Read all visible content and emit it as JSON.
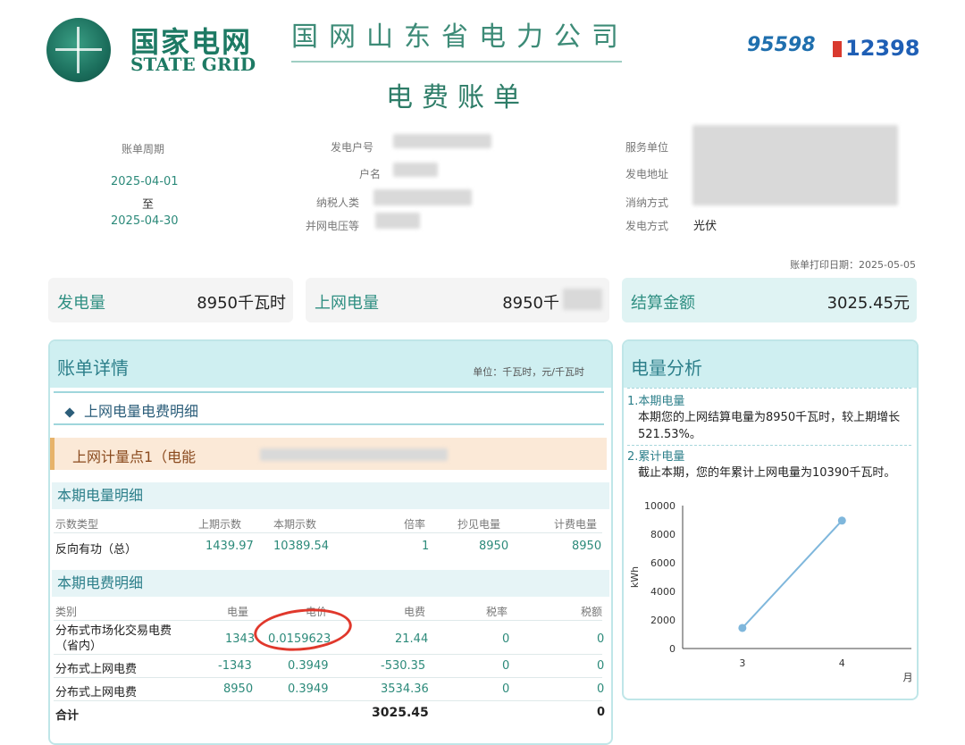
{
  "header": {
    "logo_cn": "国家电网",
    "logo_en": "STATE GRID",
    "company": "国网山东省电力公司",
    "title": "电费账单",
    "hotline1": "95598",
    "hotline2": "12398"
  },
  "info": {
    "period_label": "账单周期",
    "period_from": "2025-04-01",
    "period_to_word": "至",
    "period_to": "2025-04-30",
    "gen_account_label": "发电户号",
    "account_name_label": "户名",
    "taxpayer_label": "纳税人类",
    "voltage_label": "并网电压等",
    "service_unit_label": "服务单位",
    "gen_address_label": "发电地址",
    "consume_label": "消纳方式",
    "gen_mode_label": "发电方式",
    "gen_mode_value": "光伏",
    "print_date": "账单打印日期：2025-05-05"
  },
  "summary": {
    "gen_label": "发电量",
    "gen_value": "8950千瓦时",
    "grid_label": "上网电量",
    "grid_value": "8950千",
    "settle_label": "结算金额",
    "settle_value": "3025.45元"
  },
  "detail": {
    "title": "账单详情",
    "unit": "单位：千瓦时，元/千瓦时",
    "section": "上网电量电费明细",
    "meter": "上网计量点1（电能",
    "energy_head": "本期电量明细",
    "energy_cols": [
      "示数类型",
      "上期示数",
      "本期示数",
      "倍率",
      "抄见电量",
      "计费电量"
    ],
    "energy_row": [
      "反向有功（总）",
      "1439.97",
      "10389.54",
      "1",
      "8950",
      "8950"
    ],
    "fee_head": "本期电费明细",
    "fee_cols": [
      "类别",
      "电量",
      "电价",
      "电费",
      "税率",
      "税额"
    ],
    "fee_rows": [
      [
        "分布式市场化交易电费（省内）",
        "1343",
        "0.0159623",
        "21.44",
        "0",
        "0"
      ],
      [
        "分布式上网电费",
        "-1343",
        "0.3949",
        "-530.35",
        "0",
        "0"
      ],
      [
        "分布式上网电费",
        "8950",
        "0.3949",
        "3534.36",
        "0",
        "0"
      ]
    ],
    "total_label": "合计",
    "total_fee": "3025.45",
    "total_tax": "0"
  },
  "analysis": {
    "title": "电量分析",
    "h1": "1.本期电量",
    "t1": "本期您的上网结算电量为8950千瓦时，较上期增长521.53%。",
    "h2": "2.累计电量",
    "t2": "截止本期，您的年累计上网电量为10390千瓦时。"
  },
  "chart_data": {
    "type": "line",
    "x": [
      3,
      4
    ],
    "values": [
      1440,
      8950
    ],
    "xlabel": "月",
    "ylabel": "kWh",
    "ylim": [
      0,
      10000
    ],
    "yticks": [
      "0",
      "2000",
      "4000",
      "6000",
      "8000",
      "10000"
    ],
    "xticks": [
      "3",
      "4"
    ],
    "color": "#7fb7dc"
  }
}
